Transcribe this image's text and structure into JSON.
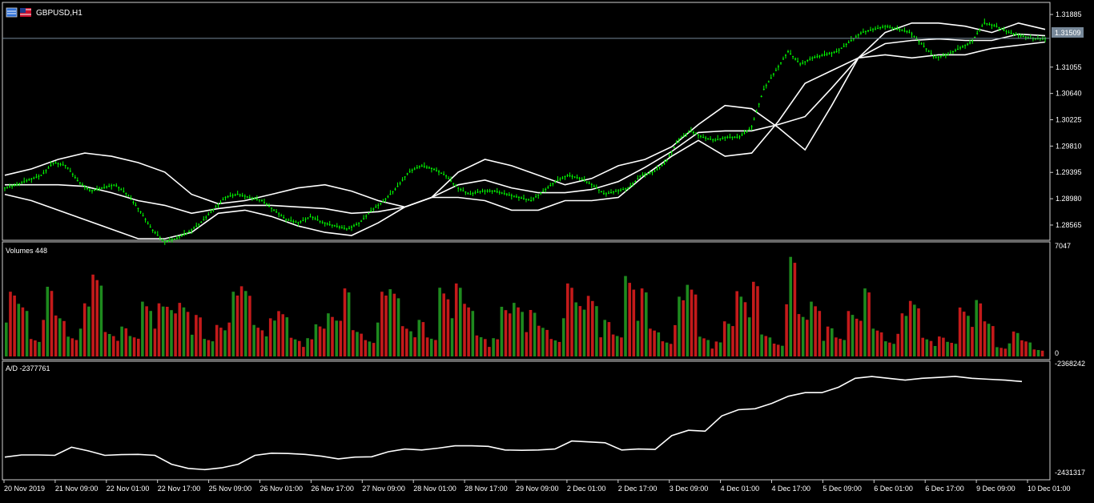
{
  "window": {
    "symbol_label": "GBPUSD,H1",
    "icons": [
      "window-icon",
      "flag-icon"
    ]
  },
  "colors": {
    "background": "#000000",
    "frame": "#cfcfcf",
    "candle": "#00ff00",
    "bands": "#ffffff",
    "volume_up": "#1e8a1e",
    "volume_down": "#c41a1a",
    "ad_line": "#ffffff",
    "price_line": "#778899",
    "price_label_bg": "#778899"
  },
  "chart_data": [
    {
      "type": "candlestick",
      "panel": "price",
      "title": "GBPUSD,H1",
      "indicator": "Bollinger Bands",
      "ylim": [
        1.2835,
        1.3205
      ],
      "y_ticks": [
        "1.31885",
        "1.31055",
        "1.30640",
        "1.30225",
        "1.29810",
        "1.29395",
        "1.28980",
        "1.28565"
      ],
      "current_price": "1.31509",
      "x_ticks": [
        "20 Nov 2019",
        "21 Nov 09:00",
        "22 Nov 01:00",
        "22 Nov 17:00",
        "25 Nov 09:00",
        "26 Nov 01:00",
        "26 Nov 17:00",
        "27 Nov 09:00",
        "28 Nov 01:00",
        "28 Nov 17:00",
        "29 Nov 09:00",
        "2 Dec 01:00",
        "2 Dec 17:00",
        "3 Dec 09:00",
        "4 Dec 01:00",
        "4 Dec 17:00",
        "5 Dec 09:00",
        "6 Dec 01:00",
        "6 Dec 17:00",
        "9 Dec 09:00",
        "10 Dec 01:00"
      ],
      "close_series_approx": [
        1.2915,
        1.292,
        1.2928,
        1.2935,
        1.2955,
        1.295,
        1.2925,
        1.291,
        1.2915,
        1.292,
        1.2905,
        1.288,
        1.285,
        1.283,
        1.2835,
        1.2845,
        1.286,
        1.288,
        1.29,
        1.2905,
        1.29,
        1.2895,
        1.288,
        1.2865,
        1.286,
        1.287,
        1.286,
        1.2855,
        1.285,
        1.286,
        1.288,
        1.2895,
        1.2915,
        1.294,
        1.295,
        1.2945,
        1.2935,
        1.2915,
        1.2905,
        1.291,
        1.291,
        1.2905,
        1.29,
        1.2895,
        1.291,
        1.2925,
        1.2935,
        1.293,
        1.292,
        1.2905,
        1.291,
        1.2915,
        1.2935,
        1.294,
        1.2955,
        1.299,
        1.3005,
        1.2995,
        1.299,
        1.2995,
        1.2995,
        1.301,
        1.307,
        1.31,
        1.313,
        1.311,
        1.312,
        1.3125,
        1.313,
        1.3145,
        1.316,
        1.3165,
        1.317,
        1.3165,
        1.316,
        1.314,
        1.312,
        1.3125,
        1.3135,
        1.3145,
        1.3175,
        1.317,
        1.316,
        1.3155,
        1.315,
        1.315
      ],
      "bollinger_upper_approx": [
        1.2935,
        1.2945,
        1.296,
        1.297,
        1.2965,
        1.2955,
        1.294,
        1.2905,
        1.289,
        1.2895,
        1.2905,
        1.2915,
        1.292,
        1.291,
        1.2895,
        1.2885,
        1.29,
        1.294,
        1.296,
        1.295,
        1.2935,
        1.292,
        1.293,
        1.295,
        1.296,
        1.298,
        1.3015,
        1.3045,
        1.304,
        1.301,
        1.2975,
        1.3045,
        1.312,
        1.316,
        1.3175,
        1.3175,
        1.317,
        1.316,
        1.3175,
        1.3165
      ],
      "bollinger_lower_approx": [
        1.2905,
        1.2895,
        1.288,
        1.2865,
        1.285,
        1.2835,
        1.2835,
        1.2845,
        1.2875,
        1.288,
        1.287,
        1.2855,
        1.2845,
        1.284,
        1.286,
        1.2885,
        1.29,
        1.29,
        1.2895,
        1.288,
        1.288,
        1.2895,
        1.2895,
        1.29,
        1.2935,
        1.2965,
        1.299,
        1.2965,
        1.297,
        1.302,
        1.308,
        1.31,
        1.312,
        1.3125,
        1.312,
        1.3125,
        1.3125,
        1.3135,
        1.314,
        1.3145
      ]
    },
    {
      "type": "bar",
      "panel": "volume",
      "title": "Volumes 448",
      "ylim": [
        0,
        7047
      ],
      "y_ticks": [
        "7047",
        "0"
      ],
      "values_approx": [
        3900,
        3600,
        1500,
        4200,
        2800,
        1700,
        3200,
        5600,
        2100,
        1800,
        1400,
        4700,
        3200,
        3400,
        4600,
        2500,
        1200,
        2700,
        3900,
        4800,
        2700,
        2300,
        3100,
        1600,
        1100,
        2200,
        3700,
        4100,
        1800,
        1400,
        3900,
        4600,
        2600,
        2200,
        1300,
        5900,
        4400,
        3600,
        1800,
        1100,
        3400,
        4600,
        2800,
        2100,
        1500,
        4400,
        3700,
        5200,
        2200,
        1500,
        6900,
        4100,
        1900,
        1300,
        3600,
        4900,
        1700,
        900,
        2400,
        5600,
        4500,
        1500,
        1100,
        6000,
        2900,
        4700,
        1800,
        1300,
        3900,
        4100,
        1900,
        1300,
        2600,
        3800,
        1600,
        1200,
        1000,
        4200,
        3400,
        2400,
        800,
        1500,
        1100,
        600
      ],
      "bar_colors": "alternating green (up) / red (down)"
    },
    {
      "type": "line",
      "panel": "accumulation_distribution",
      "title": "A/D -2377761",
      "ylim": [
        -2431317,
        -2368242
      ],
      "y_ticks": [
        "-2368242",
        "-2431317"
      ],
      "values_approx": [
        -2420000,
        -2418800,
        -2418800,
        -2419000,
        -2414500,
        -2416500,
        -2419000,
        -2418600,
        -2418500,
        -2419000,
        -2424000,
        -2426300,
        -2427000,
        -2426000,
        -2424000,
        -2419000,
        -2417800,
        -2418000,
        -2418500,
        -2419500,
        -2421000,
        -2420000,
        -2419800,
        -2417000,
        -2415500,
        -2416000,
        -2415000,
        -2413700,
        -2413700,
        -2414000,
        -2416000,
        -2416200,
        -2416000,
        -2415500,
        -2411000,
        -2411500,
        -2412000,
        -2416000,
        -2415500,
        -2415700,
        -2408000,
        -2405000,
        -2405500,
        -2397000,
        -2393500,
        -2393000,
        -2390000,
        -2386000,
        -2384000,
        -2384000,
        -2381000,
        -2376000,
        -2375000,
        -2376000,
        -2377000,
        -2376000,
        -2375500,
        -2374900,
        -2376000,
        -2376500,
        -2377000,
        -2377761
      ]
    }
  ]
}
